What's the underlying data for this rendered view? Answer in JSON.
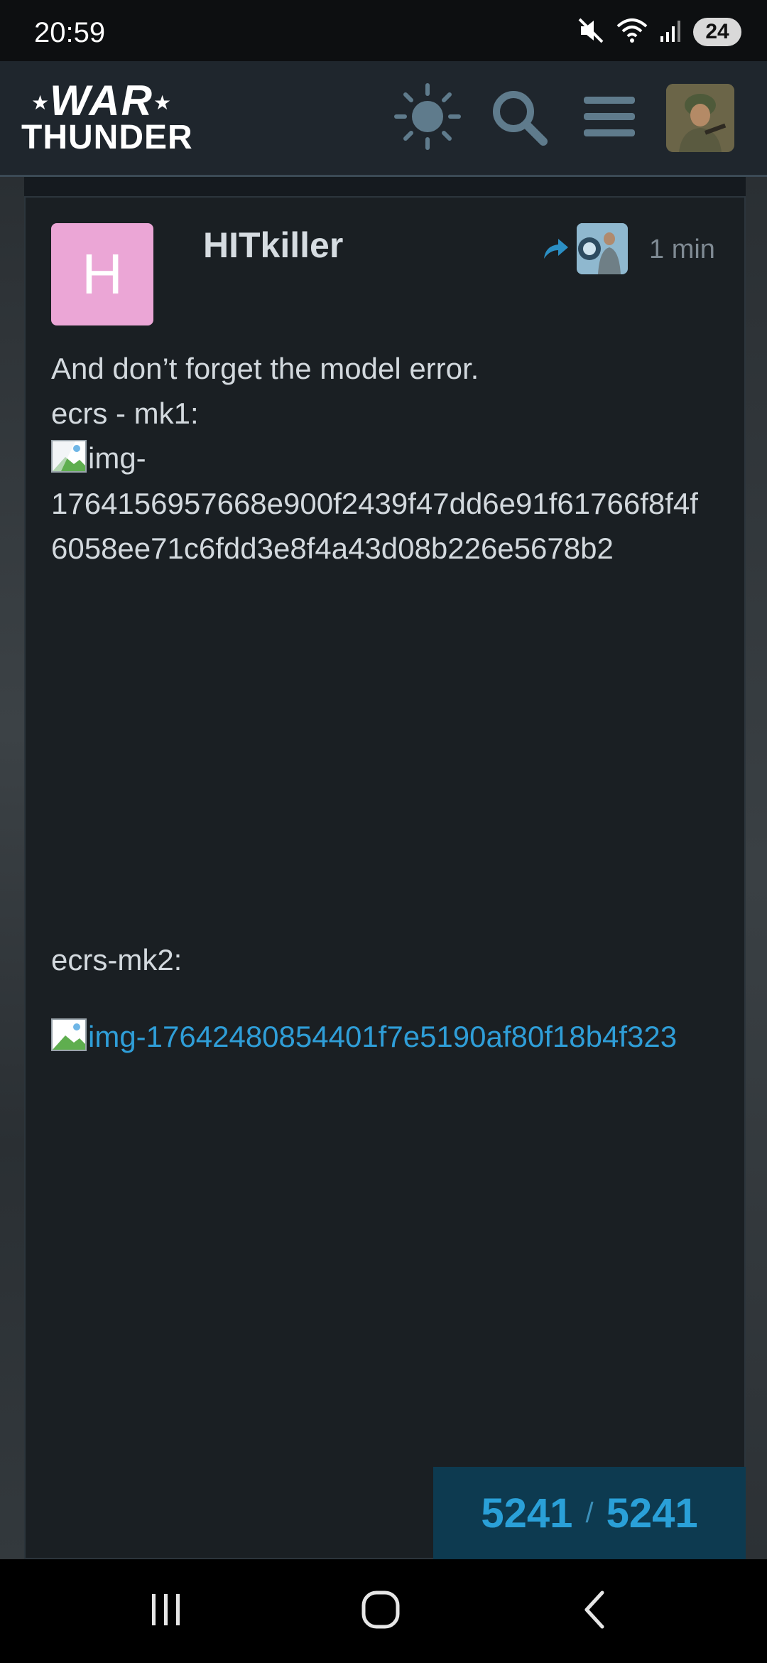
{
  "status_bar": {
    "time": "20:59",
    "battery": "24",
    "icons": [
      "mute-icon",
      "wifi-icon",
      "signal-icon",
      "battery-icon"
    ]
  },
  "header": {
    "logo_line1": "WAR",
    "logo_line2": "THUNDER",
    "icons": [
      "theme-toggle-icon",
      "search-icon",
      "menu-icon",
      "user-avatar"
    ]
  },
  "post": {
    "avatar_letter": "H",
    "avatar_color": "#eba6d6",
    "username": "HITkiller",
    "time_ago": "1 min",
    "body_line1": "And don’t forget the model error.",
    "label_mk1": "ecrs - mk1:",
    "image1_alt_prefix": "img-",
    "image1_alt_rest": "1764156957668e900f2439f47dd6e91f61766f8f4f6058ee71c6fdd3e8f4a43d08b226e5678b2",
    "label_mk2": "ecrs-mk2:",
    "image2_link": "img-17642480854401f7e5190af80f18b4f323"
  },
  "progress": {
    "current": "5241",
    "separator": "/",
    "total": "5241"
  },
  "colors": {
    "accent": "#2aa0d8",
    "background": "#151a1f",
    "header": "#1f262d"
  }
}
